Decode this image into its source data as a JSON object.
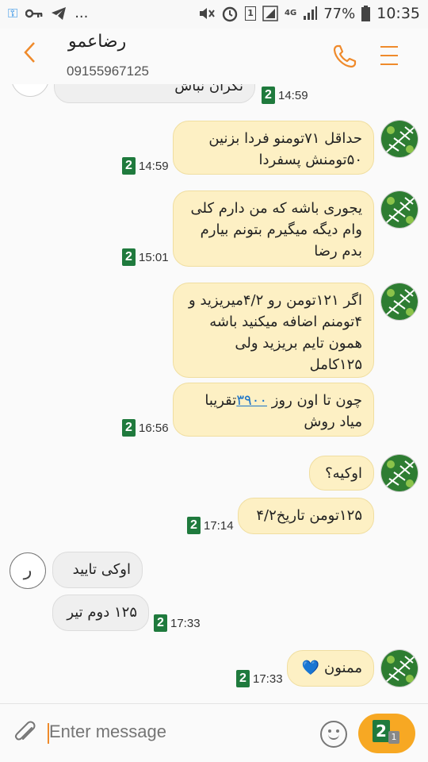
{
  "status_bar": {
    "icons_left": [
      "key-icon",
      "key-icon",
      "telegram-icon",
      "more-icon"
    ],
    "dots": "...",
    "sim_slot": "1",
    "network": "4G",
    "battery": "77%",
    "time": "10:35"
  },
  "header": {
    "contact_name": "رضاعمو",
    "phone_number": "09155967125"
  },
  "messages": [
    {
      "type": "sent",
      "text": "نگران نباش",
      "time": "14:59",
      "sim": "2"
    },
    {
      "type": "sent",
      "text": "حداقل ۷۱تومنو فردا بزنین ۵۰تومنش پسفردا",
      "time": "14:59",
      "sim": "2"
    },
    {
      "type": "sent",
      "text": "یجوری باشه که من دارم کلی وام دیگه میگیرم بتونم بیارم بدم رضا",
      "time": "15:01",
      "sim": "2"
    },
    {
      "type": "sent",
      "text": "اگر ۱۲۱تومن رو ۴/۲میریزید و ۴تومنم اضافه میکنید باشه همون تایم بریزید ولی ۱۲۵کامل",
      "time": "",
      "sim": ""
    },
    {
      "type": "sent",
      "text_before": "چون تا اون روز ",
      "link": "۳۹۰۰",
      "text_after": "تقریبا میاد روش",
      "time": "16:56",
      "sim": "2"
    },
    {
      "type": "sent",
      "text": "اوکیه؟",
      "time": "",
      "sim": ""
    },
    {
      "type": "sent",
      "text": "۱۲۵تومن تاریخ۴/۲",
      "time": "17:14",
      "sim": "2"
    },
    {
      "type": "received",
      "text": "اوکی تایید",
      "time": "",
      "sim": "",
      "avatar_letter": "ر"
    },
    {
      "type": "received",
      "text": "۱۲۵ دوم تیر",
      "time": "17:33",
      "sim": "2"
    },
    {
      "type": "sent",
      "text": "ممنون",
      "emoji": "💙",
      "time": "17:33",
      "sim": "2"
    }
  ],
  "composer": {
    "placeholder": "Enter message",
    "send_sim": "2",
    "send_sim_small": "1"
  },
  "colors": {
    "accent": "#ef8a2b",
    "sent_bubble": "#fdf0c4",
    "received_bubble": "#efefef",
    "sim_badge": "#1f7a3d",
    "send_button": "#f7a823"
  }
}
